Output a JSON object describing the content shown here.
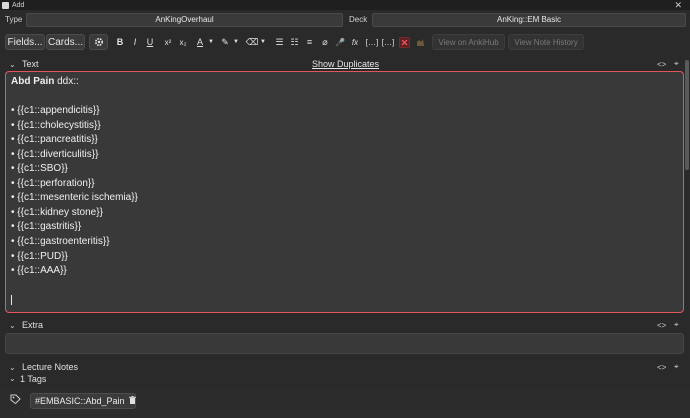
{
  "window": {
    "title": "Add",
    "close_glyph": "✕"
  },
  "note_type": {
    "label": "Type",
    "value": "AnKingOverhaul"
  },
  "deck": {
    "label": "Deck",
    "value": "AnKing::EM Basic"
  },
  "toolbar": {
    "fields_label": "Fields...",
    "cards_label": "Cards...",
    "view_ankihub_label": "View on AnkiHub",
    "view_note_history_label": "View Note History",
    "bold": "B",
    "italic": "I",
    "underline": "U",
    "superscript": "x²",
    "subscript": "x₂",
    "text_color": "A",
    "highlight": "✎",
    "eraser": "⌫",
    "bullet_list": "☰",
    "numbered_list": "☷",
    "align": "≡",
    "attach": "⌀",
    "record": "🎤",
    "math": "fx",
    "cloze": "[…]",
    "cloze_same": "[…]",
    "accent_color": "#e2575b"
  },
  "fields": {
    "text": {
      "name": "Text",
      "show_duplicates": "Show Duplicates",
      "title_bold": "Abd Pain",
      "title_rest": " ddx::",
      "items": [
        "• {{c1::appendicitis}}",
        "• {{c1::cholecystitis}}",
        "• {{c1::pancreatitis}}",
        "• {{c1::diverticulitis}}",
        "• {{c1::SBO}}",
        "• {{c1::perforation}}",
        "• {{c1::mesenteric ischemia}}",
        "• {{c1::kidney stone}}",
        "• {{c1::gastritis}}",
        "• {{c1::gastroenteritis}}",
        "• {{c1::PUD}}",
        "• {{c1::AAA}}"
      ]
    },
    "extra": {
      "name": "Extra"
    },
    "lecture_notes": {
      "name": "Lecture Notes"
    }
  },
  "tags": {
    "header": "1 Tags",
    "items": [
      "#EMBASIC::Abd_Pain"
    ]
  }
}
